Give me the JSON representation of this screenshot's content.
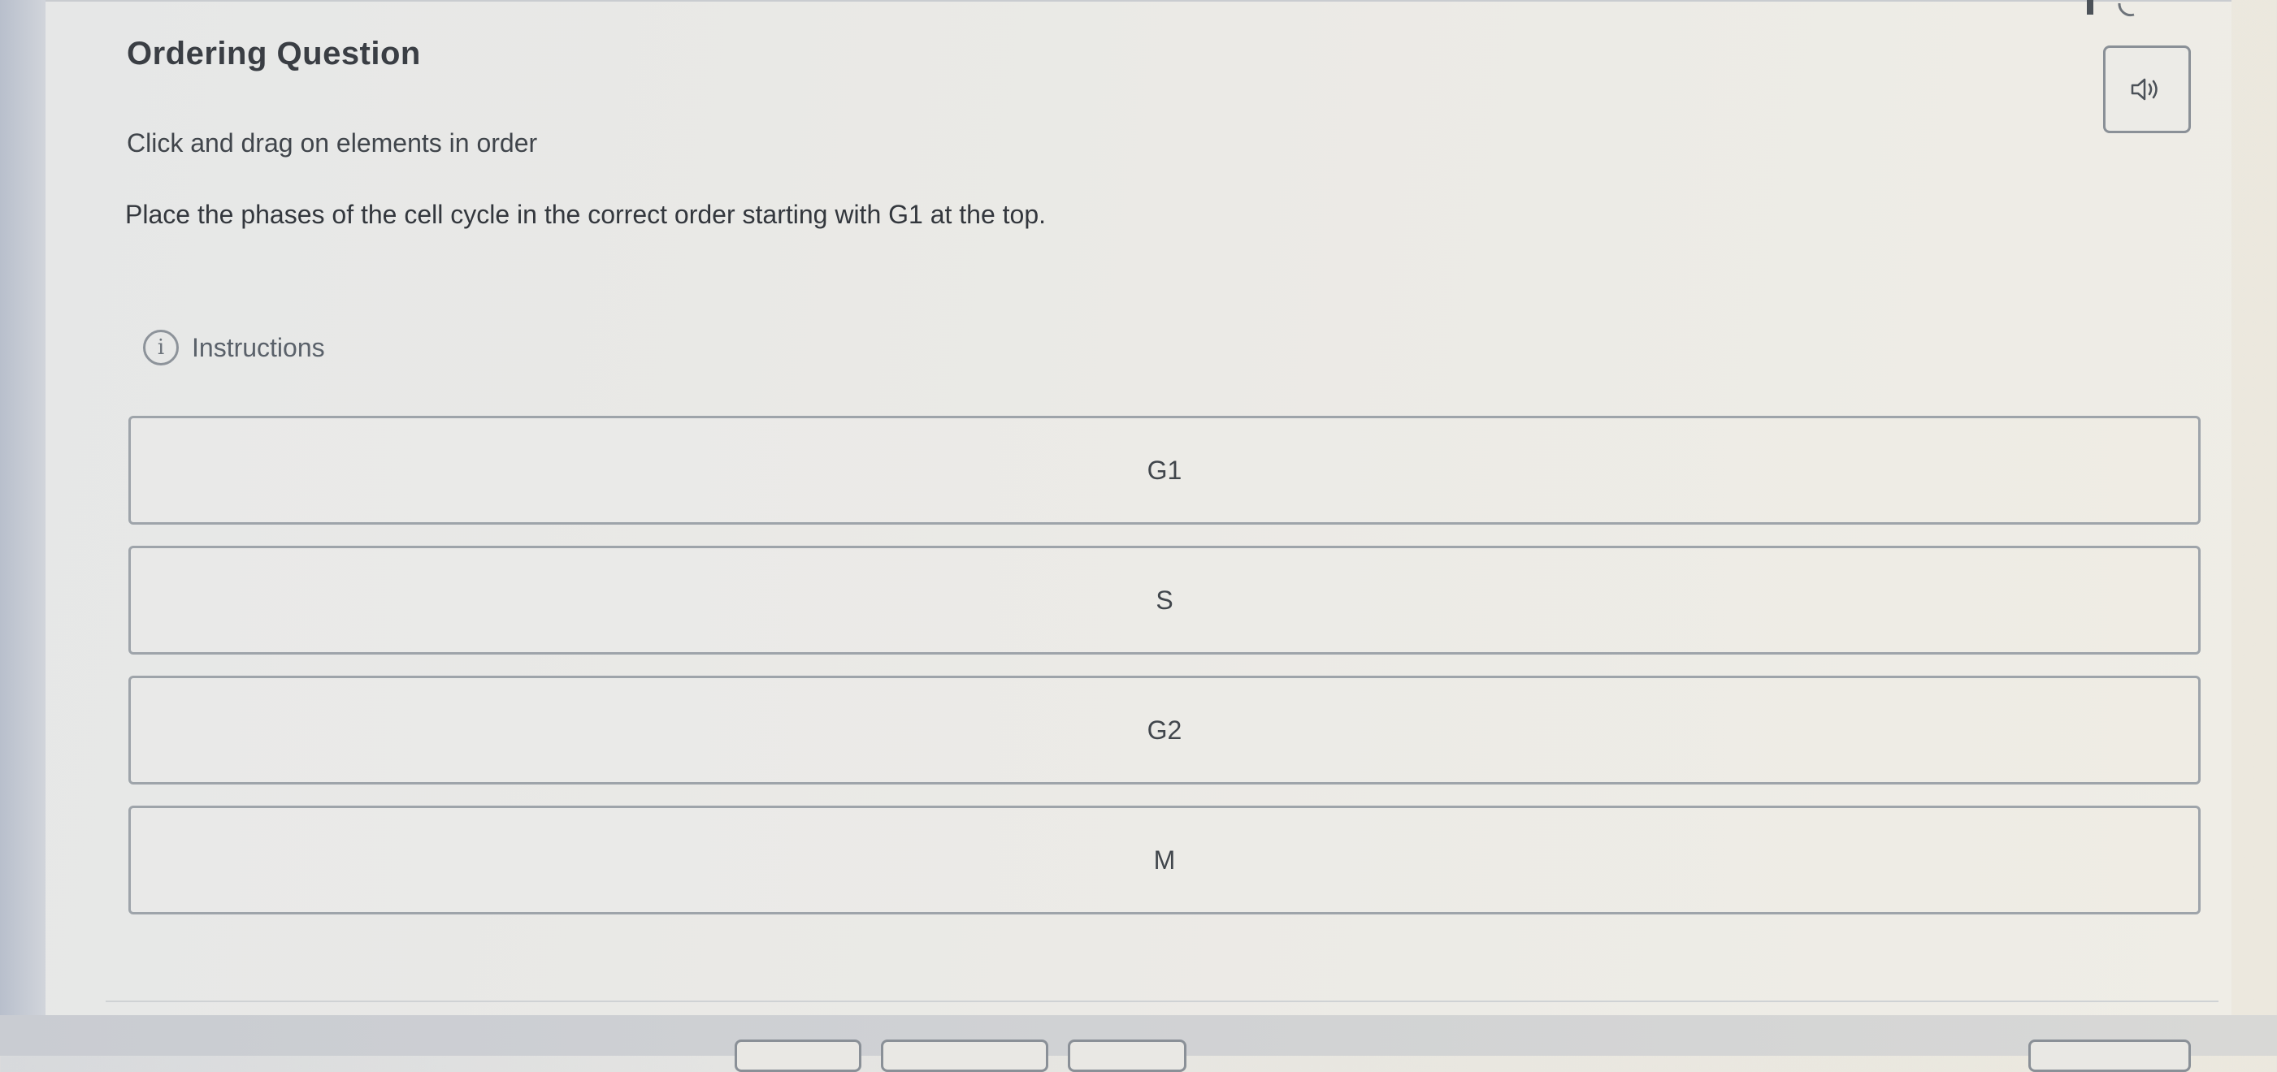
{
  "header": {
    "title": "Ordering Question"
  },
  "prompt": {
    "text": "Click and drag on elements in order"
  },
  "question": {
    "text": "Place the phases of the cell cycle in the correct order starting with G1 at the top."
  },
  "instructions": {
    "label": "Instructions",
    "icon": "info-icon"
  },
  "audio": {
    "icon": "speaker-icon"
  },
  "items": [
    {
      "label": "G1"
    },
    {
      "label": "S"
    },
    {
      "label": "G2"
    },
    {
      "label": "M"
    }
  ],
  "colors": {
    "border": "#9ea4aa",
    "text": "#2f3338",
    "background": "#ebeae6"
  }
}
